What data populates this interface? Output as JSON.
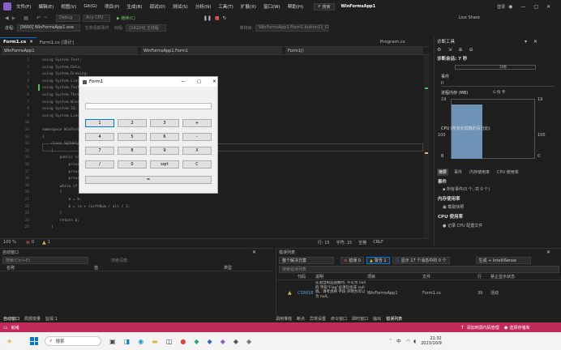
{
  "menu": {
    "items": [
      "文件(F)",
      "编辑(E)",
      "视图(V)",
      "Git(G)",
      "项目(P)",
      "生成(B)",
      "调试(D)",
      "测试(S)",
      "分析(N)",
      "工具(T)",
      "扩展(X)",
      "窗口(W)",
      "帮助(H)"
    ],
    "search_label": "搜索",
    "app_title": "WinFormsApp1",
    "login": "登录",
    "live_share": "Live Share"
  },
  "toolbar": {
    "config": "Debug",
    "platform": "Any CPU",
    "run": "▶ 继续(C)",
    "process_label": "进程:",
    "process_value": "[9600] WinFormsApp1.exe",
    "lifecycle": "生命周期事件",
    "thread_label": "线程:",
    "thread_value": "[14224] 主线程",
    "stack_label": "堆栈帧:",
    "stack_value": "WinFormsApp1.Form1.button11_Cl"
  },
  "doctabs": {
    "tab1": "Form1.cs",
    "tab2": "Form1.cs [设计]",
    "tab3": "Program.cs"
  },
  "navbar": {
    "project": "WinFormsApp1",
    "class": "WinFormsApp1.Form1",
    "member": "Form1()"
  },
  "code": {
    "lines": [
      {
        "n": "1",
        "t": "using System.Text;"
      },
      {
        "n": "2",
        "t": "using System.Data;"
      },
      {
        "n": "3",
        "t": "using System.Drawing;"
      },
      {
        "n": "4",
        "t": "using System.Linq;"
      },
      {
        "n": "5",
        "t": "using System.Text;"
      },
      {
        "n": "6",
        "t": "using System.Threading.Tasks;"
      },
      {
        "n": "7",
        "t": "using System.Windows.Forms;"
      },
      {
        "n": "8",
        "t": "using System.IO;"
      },
      {
        "n": "9",
        "t": "using System.Linq;"
      },
      {
        "n": "10",
        "t": ""
      },
      {
        "n": "11",
        "t": "namespace WinFormsApp1"
      },
      {
        "n": "12",
        "t": "{"
      },
      {
        "n": "13",
        "t": "    class SqlHelper"
      },
      {
        "n": "14",
        "t": "    {"
      },
      {
        "n": "15",
        "t": "        public int a, b, c, d;"
      },
      {
        "n": "16",
        "t": "            private string f;"
      },
      {
        "n": "17",
        "t": "            private int x;"
      },
      {
        "n": "18",
        "t": "            private int s;"
      },
      {
        "n": "19",
        "t": "        while (f == \"+\" || f == \"-\") // 当前计算值"
      },
      {
        "n": "20",
        "t": "        {"
      },
      {
        "n": "21",
        "t": "            a = b;"
      },
      {
        "n": "22",
        "t": "            b = (a + (LeftNum / all / 2;"
      },
      {
        "n": "23",
        "t": "        }"
      },
      {
        "n": "24",
        "t": "        return b;"
      },
      {
        "n": "25",
        "t": "    }"
      }
    ]
  },
  "editor_status": {
    "zoom": "100 %",
    "errors": "0",
    "warnings": "1",
    "position": "行: 15",
    "char": "字符: 15",
    "spaces": "空格",
    "crlf": "CRLF"
  },
  "form": {
    "title": "Form1",
    "buttons": [
      [
        "1",
        "2",
        "3",
        "+"
      ],
      [
        "4",
        "5",
        "6",
        "-"
      ],
      [
        "7",
        "8",
        "9",
        "X"
      ],
      [
        "/",
        "0",
        "sqrt",
        "C"
      ]
    ],
    "equals": "="
  },
  "diag": {
    "title": "诊断工具",
    "session": "诊断会话: 7 秒",
    "tick": "10秒",
    "events": "事件",
    "memory": "进程内存 (MB)",
    "memory_legend": "G  快  专",
    "mem_max": "19",
    "mem_min": "0",
    "cpu": "CPU (所有处理器的百分比)",
    "cpu_max": "100",
    "cpu_min": "0",
    "tabs": [
      "摘要",
      "事件",
      "内存使用率",
      "CPU 使用率"
    ],
    "sec_events": "事件",
    "all_events": "所有事件(0 个, 共 0 个)",
    "sec_mem": "内存使用率",
    "snapshot": "截取快照",
    "sec_cpu": "CPU 使用率",
    "record_cpu": "记录 CPU 配置文件"
  },
  "auto": {
    "title": "自动窗口",
    "search": "搜索(Ctrl+E)",
    "depth": "搜索深度:",
    "cols": [
      "名称",
      "值",
      "类型"
    ]
  },
  "errors": {
    "title": "错误列表",
    "scope": "整个解决方案",
    "err_badge": "错误 0",
    "warn_badge": "警告 1",
    "msg_badge": "显示 17 个消息中的 0 个",
    "build": "生成 + IntelliSense",
    "search": "搜索错误列表",
    "cols": [
      "代码",
      "说明",
      "项目",
      "文件",
      "行",
      "禁止显示状态"
    ],
    "row": {
      "code": "CS8618",
      "desc": "在退出构造函数时, 不可为 null 的 字段\"Flag\"必须包含非 null 值。请考虑将 字段 声明为可以为 null。",
      "project": "WinFormsApp1",
      "file": "Form1.cs",
      "line": "39",
      "state": "活动"
    }
  },
  "bottom_tabs": {
    "left": [
      "自动窗口",
      "局部变量",
      "监视 1"
    ],
    "right": [
      "调用堆栈",
      "断点",
      "异常设置",
      "命令窗口",
      "即时窗口",
      "输出",
      "错误列表"
    ]
  },
  "status": {
    "ready": "就绪",
    "source_control": "添加到源代码管理",
    "repo": "选择存储库"
  },
  "taskbar": {
    "search": "搜索",
    "time": "21:32",
    "date": "2023/10/9",
    "lang": "中"
  }
}
